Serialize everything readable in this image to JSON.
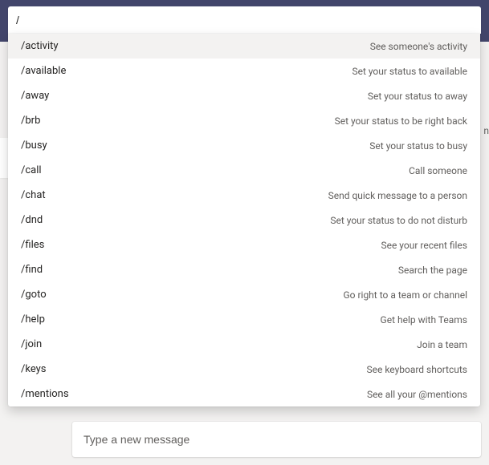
{
  "search": {
    "value": "/"
  },
  "commands": [
    {
      "name": "/activity",
      "description": "See someone's activity",
      "highlight": true
    },
    {
      "name": "/available",
      "description": "Set your status to available",
      "highlight": false
    },
    {
      "name": "/away",
      "description": "Set your status to away",
      "highlight": false
    },
    {
      "name": "/brb",
      "description": "Set your status to be right back",
      "highlight": false
    },
    {
      "name": "/busy",
      "description": "Set your status to busy",
      "highlight": false
    },
    {
      "name": "/call",
      "description": "Call someone",
      "highlight": false
    },
    {
      "name": "/chat",
      "description": "Send quick message to a person",
      "highlight": false
    },
    {
      "name": "/dnd",
      "description": "Set your status to do not disturb",
      "highlight": false
    },
    {
      "name": "/files",
      "description": "See your recent files",
      "highlight": false
    },
    {
      "name": "/find",
      "description": "Search the page",
      "highlight": false
    },
    {
      "name": "/goto",
      "description": "Go right to a team or channel",
      "highlight": false
    },
    {
      "name": "/help",
      "description": "Get help with Teams",
      "highlight": false
    },
    {
      "name": "/join",
      "description": "Join a team",
      "highlight": false
    },
    {
      "name": "/keys",
      "description": "See keyboard shortcuts",
      "highlight": false
    },
    {
      "name": "/mentions",
      "description": "See all your @mentions",
      "highlight": false
    }
  ],
  "compose": {
    "placeholder": "Type a new message"
  },
  "stray_text": "n"
}
